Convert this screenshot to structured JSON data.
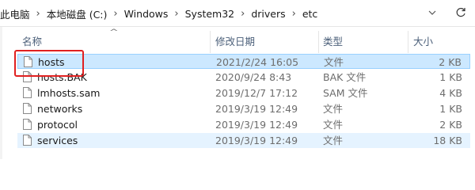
{
  "address_bar": {
    "crumbs": [
      "此电脑",
      "本地磁盘 (C:)",
      "Windows",
      "System32",
      "drivers",
      "etc"
    ]
  },
  "columns": {
    "name": "名称",
    "date": "修改日期",
    "type": "类型",
    "size": "大小"
  },
  "files": [
    {
      "name": "hosts",
      "date": "2021/2/24 16:05",
      "type": "文件",
      "size": "2 KB"
    },
    {
      "name": "hosts.BAK",
      "date": "2020/9/24 8:43",
      "type": "BAK 文件",
      "size": "1 KB"
    },
    {
      "name": "lmhosts.sam",
      "date": "2019/12/7 17:12",
      "type": "SAM 文件",
      "size": "4 KB"
    },
    {
      "name": "networks",
      "date": "2019/3/19 12:49",
      "type": "文件",
      "size": "1 KB"
    },
    {
      "name": "protocol",
      "date": "2019/3/19 12:49",
      "type": "文件",
      "size": "2 KB"
    },
    {
      "name": "services",
      "date": "2019/3/19 12:49",
      "type": "文件",
      "size": "18 KB"
    }
  ],
  "selected_file": "hosts",
  "highlight_color": "#e02020"
}
